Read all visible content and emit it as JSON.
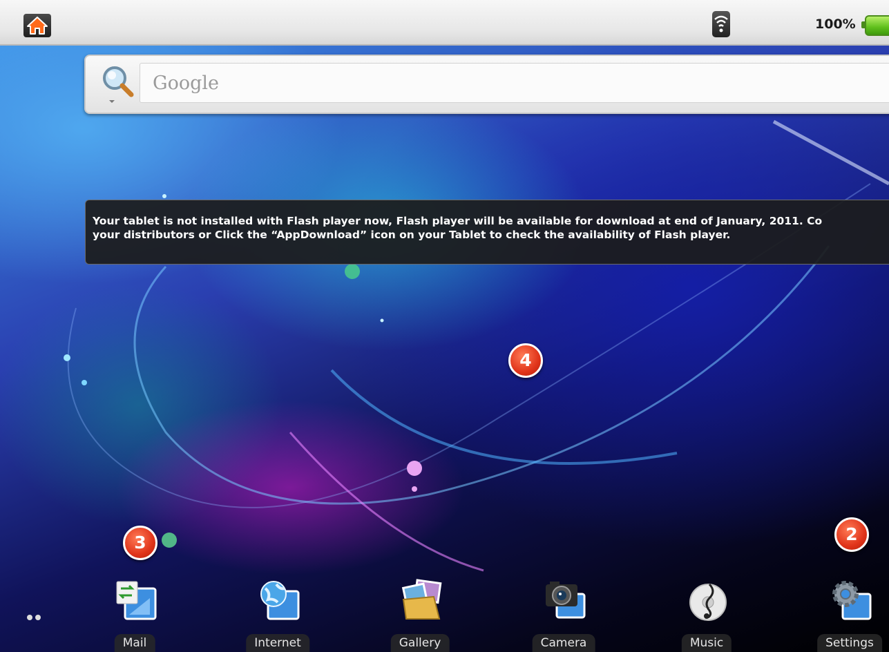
{
  "status_bar": {
    "battery_percent": "100%"
  },
  "search": {
    "placeholder": "Google"
  },
  "toast": {
    "line1": "Your tablet is not installed with Flash player now, Flash player will be available for download at end of January, 2011. Co",
    "line2": "your distributors or Click the “AppDownload” icon on your Tablet to check the availability of Flash player."
  },
  "badges": {
    "b2": "2",
    "b3": "3",
    "b4": "4"
  },
  "dock": {
    "items": [
      {
        "label": "Mail",
        "icon": "mail-icon"
      },
      {
        "label": "Internet",
        "icon": "internet-icon"
      },
      {
        "label": "Gallery",
        "icon": "gallery-icon"
      },
      {
        "label": "Camera",
        "icon": "camera-icon"
      },
      {
        "label": "Music",
        "icon": "music-icon"
      },
      {
        "label": "Settings",
        "icon": "settings-icon"
      }
    ]
  },
  "colors": {
    "badge": "#e0341a",
    "battery": "#5fbf1c",
    "toast_bg": "#1c1c1c"
  }
}
